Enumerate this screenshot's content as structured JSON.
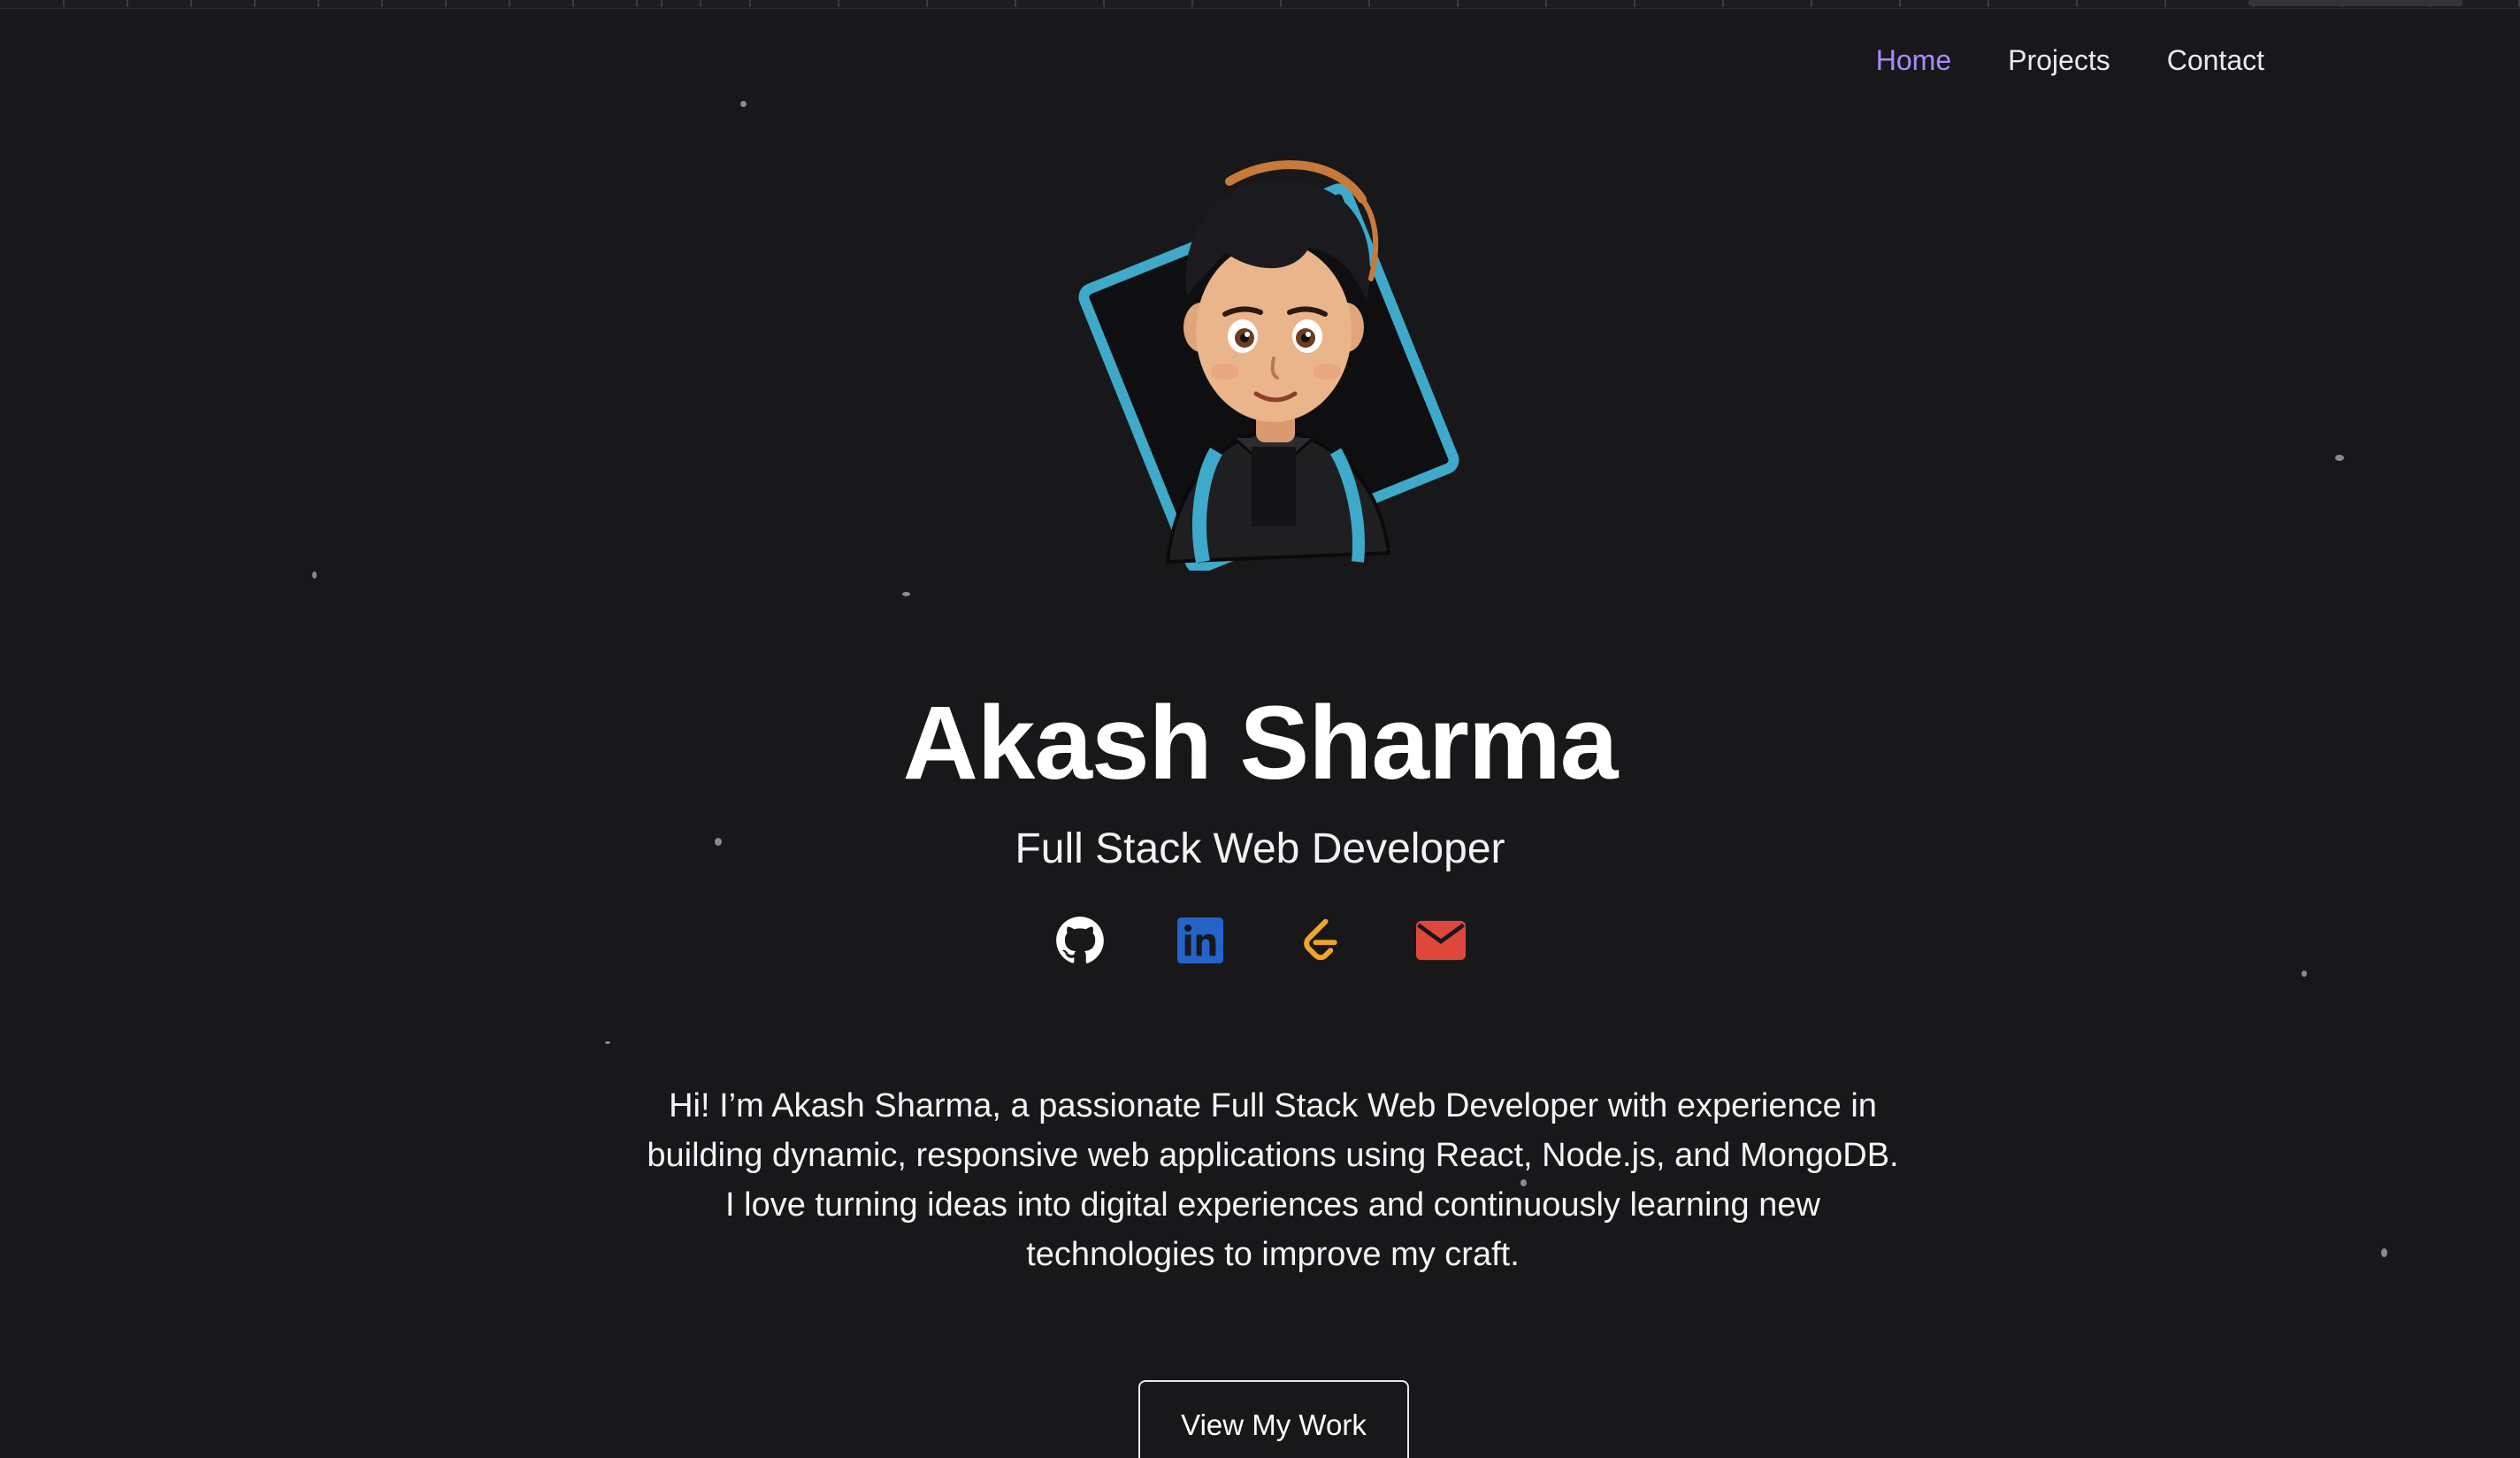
{
  "nav": {
    "items": [
      {
        "label": "Home",
        "active": true
      },
      {
        "label": "Projects",
        "active": false
      },
      {
        "label": "Contact",
        "active": false
      }
    ],
    "active_color": "#a78bfa"
  },
  "hero": {
    "name": "Akash Sharma",
    "role": "Full Stack Web Developer",
    "bio": "Hi! I’m Akash Sharma, a passionate Full Stack Web Developer with experience in building dynamic, responsive web applications using React, Node.js, and MongoDB. I love turning ideas into digital experiences and continuously learning new technologies to improve my craft.",
    "cta_label": "View My Work"
  },
  "socials": [
    {
      "icon": "github-icon",
      "color": "#ffffff"
    },
    {
      "icon": "linkedin-icon",
      "color": "#2563c9"
    },
    {
      "icon": "leetcode-icon",
      "color": "#f0a52b"
    },
    {
      "icon": "mail-icon",
      "color": "#e0473c"
    }
  ],
  "colors": {
    "background": "#18181a",
    "avatar_frame": "#3fa9c9"
  }
}
